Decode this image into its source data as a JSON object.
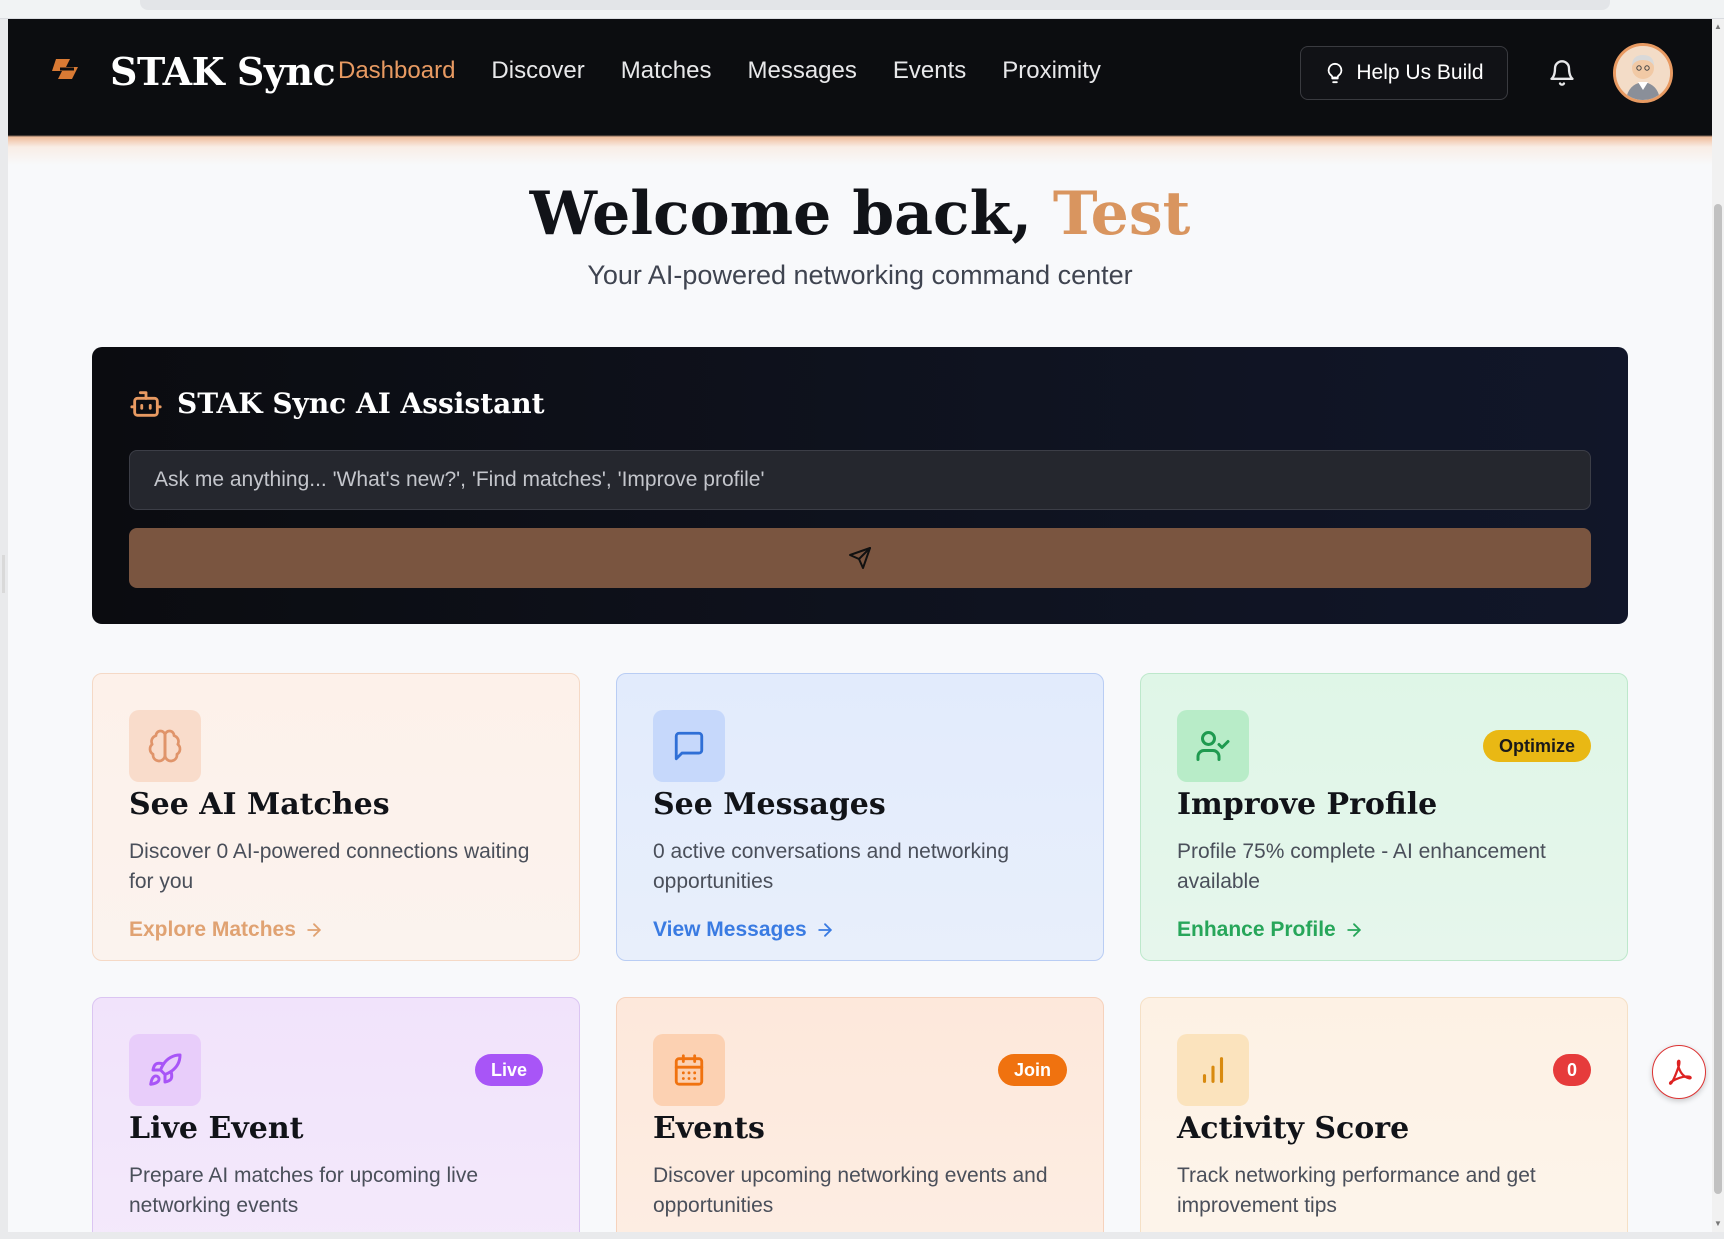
{
  "app": {
    "brand": "STAK Sync",
    "accent_color": "#e89a62"
  },
  "nav": {
    "links": [
      {
        "label": "Dashboard",
        "active": true
      },
      {
        "label": "Discover",
        "active": false
      },
      {
        "label": "Matches",
        "active": false
      },
      {
        "label": "Messages",
        "active": false
      },
      {
        "label": "Events",
        "active": false
      },
      {
        "label": "Proximity",
        "active": false
      }
    ],
    "help_button": "Help Us Build"
  },
  "welcome": {
    "greeting": "Welcome back,",
    "name": "Test",
    "subtitle": "Your AI-powered networking command center"
  },
  "assistant": {
    "title": "STAK Sync AI Assistant",
    "placeholder": "Ask me anything... 'What's new?', 'Find matches', 'Improve profile'",
    "send_icon": "send-icon"
  },
  "cards": [
    {
      "title": "See AI Matches",
      "description": "Discover 0 AI-powered connections waiting for you",
      "link": "Explore Matches",
      "icon": "brain-icon",
      "badge": ""
    },
    {
      "title": "See Messages",
      "description": "0 active conversations and networking opportunities",
      "link": "View Messages",
      "icon": "message-square-icon",
      "badge": ""
    },
    {
      "title": "Improve Profile",
      "description": "Profile 75% complete - AI enhancement available",
      "link": "Enhance Profile",
      "icon": "user-check-icon",
      "badge": "Optimize"
    },
    {
      "title": "Live Event",
      "description": "Prepare AI matches for upcoming live networking events",
      "link": "",
      "icon": "rocket-icon",
      "badge": "Live"
    },
    {
      "title": "Events",
      "description": "Discover upcoming networking events and opportunities",
      "link": "",
      "icon": "calendar-icon",
      "badge": "Join"
    },
    {
      "title": "Activity Score",
      "description": "Track networking performance and get improvement tips",
      "link": "",
      "icon": "bar-chart-icon",
      "badge": "0"
    }
  ]
}
